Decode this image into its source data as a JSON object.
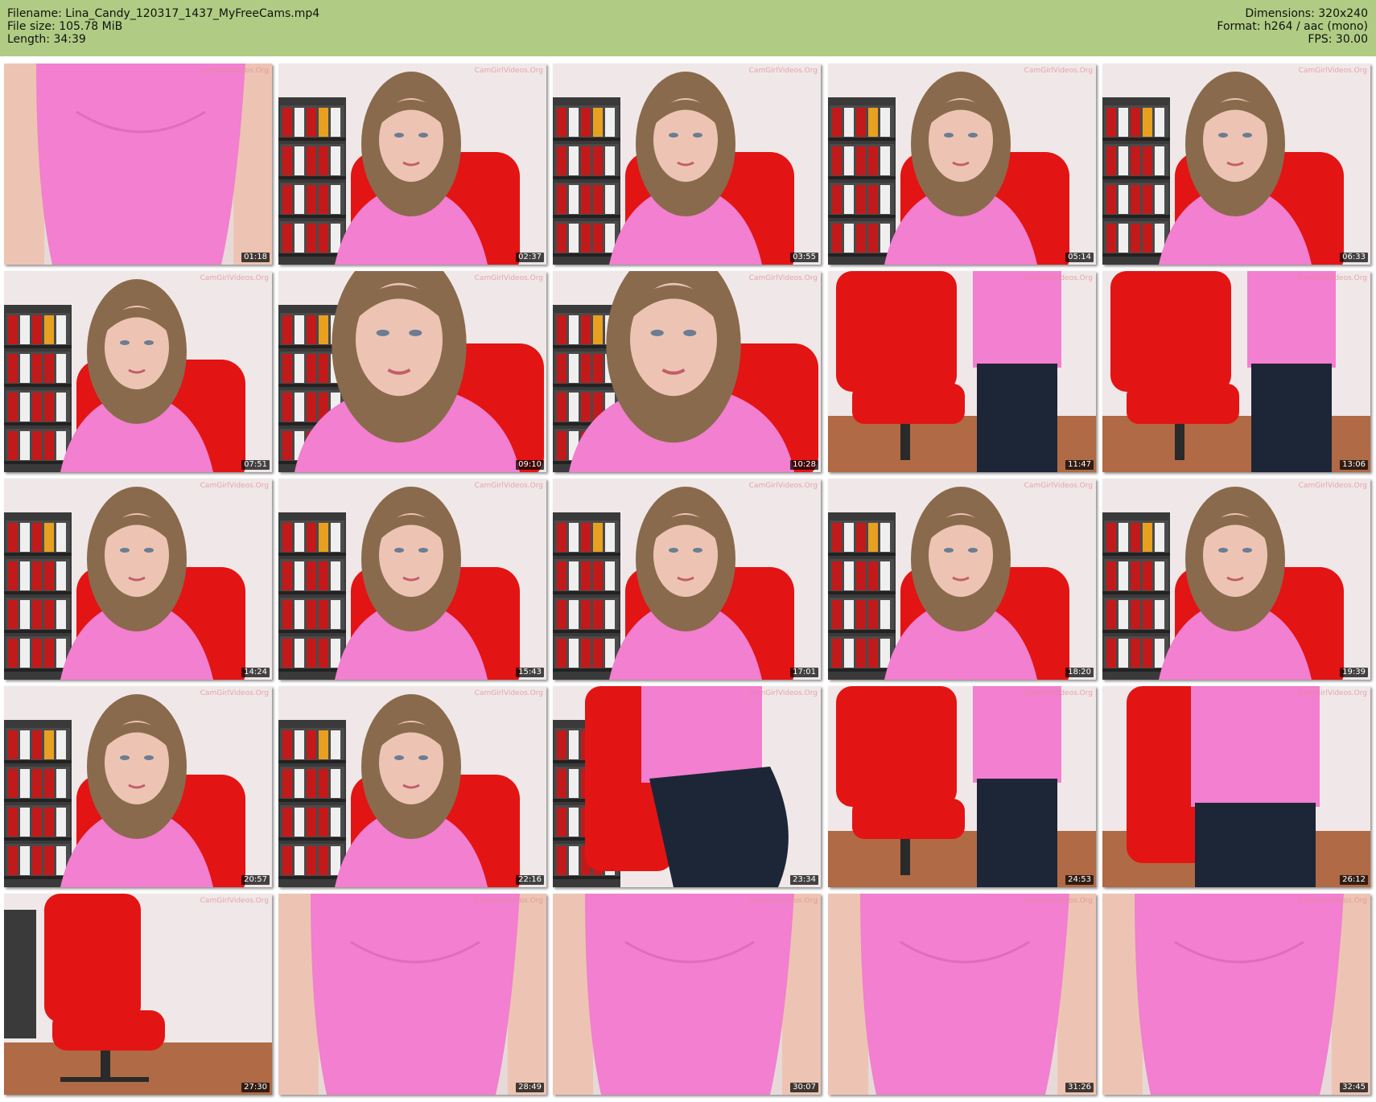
{
  "header": {
    "filename": "Filename: Lina_Candy_120317_1437_MyFreeCams.mp4",
    "filesize": "File size: 105.78 MiB",
    "length": "Length: 34:39",
    "dimensions": "Dimensions: 320x240",
    "format": "Format: h264 / aac (mono)",
    "fps": "FPS: 30.00",
    "background_color": "#b0cc84"
  },
  "watermark": "CamGirlVideos.Org",
  "colors": {
    "shirt": "#f27fcf",
    "chair": "#e31414",
    "wall": "#f0e8e8",
    "pants": "#1d2636",
    "shelf": "#3a3a3a",
    "binder_red": "#c21a1a",
    "hair": "#8a6a4c",
    "skin": "#edc4b3",
    "floor": "#b06a45"
  },
  "thumbnails": [
    {
      "time": "01:18",
      "scene": "torso-close"
    },
    {
      "time": "02:37",
      "scene": "face-chair"
    },
    {
      "time": "03:55",
      "scene": "face-chair"
    },
    {
      "time": "05:14",
      "scene": "face-chair"
    },
    {
      "time": "06:33",
      "scene": "face-chair"
    },
    {
      "time": "07:51",
      "scene": "face-chair"
    },
    {
      "time": "09:10",
      "scene": "face-close"
    },
    {
      "time": "10:28",
      "scene": "face-close"
    },
    {
      "time": "11:47",
      "scene": "standing-chair"
    },
    {
      "time": "13:06",
      "scene": "standing-chair"
    },
    {
      "time": "14:24",
      "scene": "face-chair"
    },
    {
      "time": "15:43",
      "scene": "face-chair"
    },
    {
      "time": "17:01",
      "scene": "face-chair"
    },
    {
      "time": "18:20",
      "scene": "face-chair"
    },
    {
      "time": "19:39",
      "scene": "face-chair"
    },
    {
      "time": "20:57",
      "scene": "face-chair"
    },
    {
      "time": "22:16",
      "scene": "face-chair"
    },
    {
      "time": "23:34",
      "scene": "standing-side"
    },
    {
      "time": "24:53",
      "scene": "standing-chair"
    },
    {
      "time": "26:12",
      "scene": "standing-center"
    },
    {
      "time": "27:30",
      "scene": "empty-chair"
    },
    {
      "time": "28:49",
      "scene": "torso-close"
    },
    {
      "time": "30:07",
      "scene": "torso-close"
    },
    {
      "time": "31:26",
      "scene": "torso-close"
    },
    {
      "time": "32:45",
      "scene": "torso-close"
    }
  ]
}
